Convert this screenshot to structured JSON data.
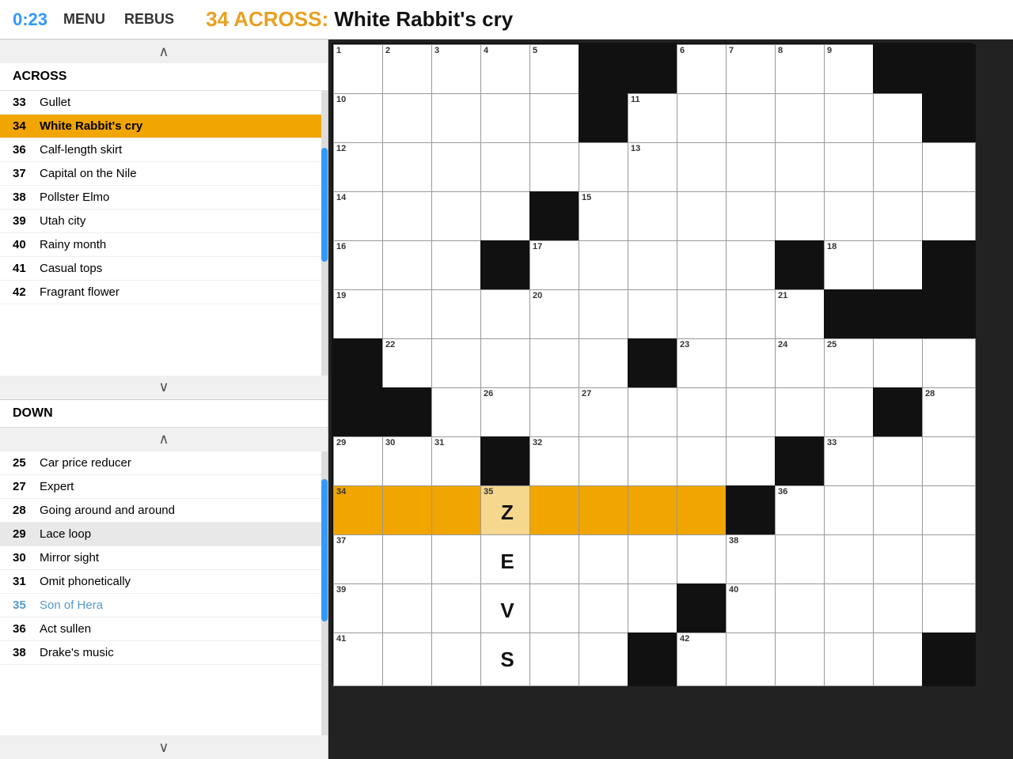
{
  "header": {
    "timer": "0:23",
    "menu_label": "MENU",
    "rebus_label": "REBUS",
    "clue_number": "34",
    "clue_direction": "ACROSS",
    "clue_text": "White Rabbit's cry"
  },
  "sidebar": {
    "across_header": "ACROSS",
    "down_header": "DOWN",
    "across_clues": [
      {
        "num": "33",
        "text": "Gullet"
      },
      {
        "num": "34",
        "text": "White Rabbit's cry",
        "active": true
      },
      {
        "num": "36",
        "text": "Calf-length skirt"
      },
      {
        "num": "37",
        "text": "Capital on the Nile"
      },
      {
        "num": "38",
        "text": "Pollster Elmo"
      },
      {
        "num": "39",
        "text": "Utah city"
      },
      {
        "num": "40",
        "text": "Rainy month"
      },
      {
        "num": "41",
        "text": "Casual tops"
      },
      {
        "num": "42",
        "text": "Fragrant flower"
      }
    ],
    "down_clues": [
      {
        "num": "25",
        "text": "Car price reducer"
      },
      {
        "num": "27",
        "text": "Expert"
      },
      {
        "num": "28",
        "text": "Going around and around"
      },
      {
        "num": "29",
        "text": "Lace loop",
        "highlighted": true
      },
      {
        "num": "30",
        "text": "Mirror sight"
      },
      {
        "num": "31",
        "text": "Omit phonetically"
      },
      {
        "num": "35",
        "text": "Son of Hera",
        "special": true
      },
      {
        "num": "36",
        "text": "Act sullen"
      },
      {
        "num": "38",
        "text": "Drake's music"
      }
    ]
  },
  "grid": {
    "cols": 13,
    "rows": 13
  }
}
